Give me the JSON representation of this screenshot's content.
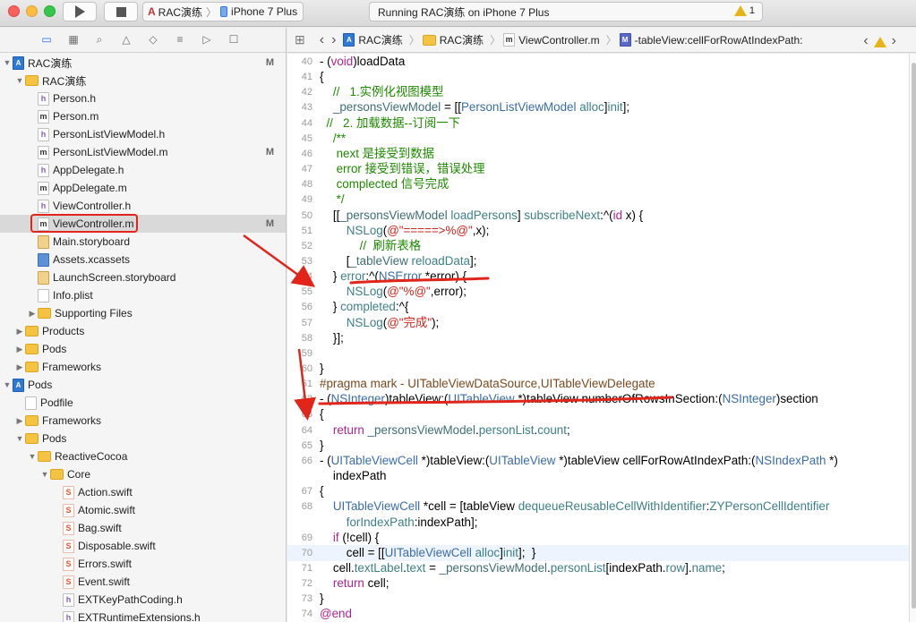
{
  "toolbar": {
    "scheme_project": "RAC演练",
    "scheme_device": "iPhone 7 Plus",
    "status": "Running RAC演练 on iPhone 7 Plus",
    "warnings": "1"
  },
  "jumpbar": {
    "items": [
      "RAC演练",
      "RAC演练",
      "ViewController.m",
      "-tableView:cellForRowAtIndexPath:"
    ]
  },
  "navigator": {
    "rows": [
      {
        "label": "RAC演练",
        "kind": "proj",
        "depth": 0,
        "disc": "▼",
        "badge": "M"
      },
      {
        "label": "RAC演练",
        "kind": "folder",
        "depth": 1,
        "disc": "▼",
        "badge": ""
      },
      {
        "label": "Person.h",
        "kind": "h",
        "depth": 2,
        "disc": "",
        "badge": ""
      },
      {
        "label": "Person.m",
        "kind": "m",
        "depth": 2,
        "disc": "",
        "badge": ""
      },
      {
        "label": "PersonListViewModel.h",
        "kind": "h",
        "depth": 2,
        "disc": "",
        "badge": ""
      },
      {
        "label": "PersonListViewModel.m",
        "kind": "m",
        "depth": 2,
        "disc": "",
        "badge": "M"
      },
      {
        "label": "AppDelegate.h",
        "kind": "h",
        "depth": 2,
        "disc": "",
        "badge": ""
      },
      {
        "label": "AppDelegate.m",
        "kind": "m",
        "depth": 2,
        "disc": "",
        "badge": ""
      },
      {
        "label": "ViewController.h",
        "kind": "h",
        "depth": 2,
        "disc": "",
        "badge": ""
      },
      {
        "label": "ViewController.m",
        "kind": "m",
        "depth": 2,
        "disc": "",
        "badge": "M",
        "selected": true
      },
      {
        "label": "Main.storyboard",
        "kind": "sb",
        "depth": 2,
        "disc": "",
        "badge": ""
      },
      {
        "label": "Assets.xcassets",
        "kind": "xc",
        "depth": 2,
        "disc": "",
        "badge": ""
      },
      {
        "label": "LaunchScreen.storyboard",
        "kind": "sb",
        "depth": 2,
        "disc": "",
        "badge": ""
      },
      {
        "label": "Info.plist",
        "kind": "plist",
        "depth": 2,
        "disc": "",
        "badge": ""
      },
      {
        "label": "Supporting Files",
        "kind": "folder",
        "depth": 2,
        "disc": "▶",
        "badge": ""
      },
      {
        "label": "Products",
        "kind": "folder",
        "depth": 1,
        "disc": "▶",
        "badge": ""
      },
      {
        "label": "Pods",
        "kind": "folder",
        "depth": 1,
        "disc": "▶",
        "badge": ""
      },
      {
        "label": "Frameworks",
        "kind": "folder",
        "depth": 1,
        "disc": "▶",
        "badge": ""
      },
      {
        "label": "Pods",
        "kind": "proj",
        "depth": 0,
        "disc": "▼",
        "badge": ""
      },
      {
        "label": "Podfile",
        "kind": "plist",
        "depth": 1,
        "disc": "",
        "badge": ""
      },
      {
        "label": "Frameworks",
        "kind": "folder",
        "depth": 1,
        "disc": "▶",
        "badge": ""
      },
      {
        "label": "Pods",
        "kind": "folder",
        "depth": 1,
        "disc": "▼",
        "badge": ""
      },
      {
        "label": "ReactiveCocoa",
        "kind": "folder",
        "depth": 2,
        "disc": "▼",
        "badge": ""
      },
      {
        "label": "Core",
        "kind": "folder",
        "depth": 3,
        "disc": "▼",
        "badge": ""
      },
      {
        "label": "Action.swift",
        "kind": "swift",
        "depth": 4,
        "disc": "",
        "badge": ""
      },
      {
        "label": "Atomic.swift",
        "kind": "swift",
        "depth": 4,
        "disc": "",
        "badge": ""
      },
      {
        "label": "Bag.swift",
        "kind": "swift",
        "depth": 4,
        "disc": "",
        "badge": ""
      },
      {
        "label": "Disposable.swift",
        "kind": "swift",
        "depth": 4,
        "disc": "",
        "badge": ""
      },
      {
        "label": "Errors.swift",
        "kind": "swift",
        "depth": 4,
        "disc": "",
        "badge": ""
      },
      {
        "label": "Event.swift",
        "kind": "swift",
        "depth": 4,
        "disc": "",
        "badge": ""
      },
      {
        "label": "EXTKeyPathCoding.h",
        "kind": "h",
        "depth": 4,
        "disc": "",
        "badge": ""
      },
      {
        "label": "EXTRuntimeExtensions.h",
        "kind": "h",
        "depth": 4,
        "disc": "",
        "badge": ""
      }
    ]
  },
  "code": {
    "lines": [
      {
        "n": "40",
        "html": "- (<span class=\"kw\">void</span>)loadData"
      },
      {
        "n": "41",
        "html": "{"
      },
      {
        "n": "42",
        "html": "    <span class=\"cm\">//   1.实例化视图模型</span>"
      },
      {
        "n": "43",
        "html": "    <span class=\"ivr\">_personsViewModel</span> = [[<span class=\"ty\">PersonListViewModel</span> <span class=\"mth\">alloc</span>]<span class=\"mth\">init</span>];"
      },
      {
        "n": "44",
        "html": "  <span class=\"cm\">//   2. 加载数据--订阅一下</span>"
      },
      {
        "n": "45",
        "html": "    <span class=\"cm\">/**</span>"
      },
      {
        "n": "46",
        "html": "     <span class=\"cm\">next 是接受到数据</span>"
      },
      {
        "n": "47",
        "html": "     <span class=\"cm\">error 接受到错误，错误处理</span>"
      },
      {
        "n": "48",
        "html": "     <span class=\"cm\">complected 信号完成</span>"
      },
      {
        "n": "49",
        "html": "     <span class=\"cm\">*/</span>"
      },
      {
        "n": "50",
        "html": "    [[<span class=\"ivr\">_personsViewModel</span> <span class=\"mth\">loadPersons</span>] <span class=\"mth\">subscribeNext</span>:^(<span class=\"kw\">id</span> x) {"
      },
      {
        "n": "51",
        "html": "        <span class=\"mth\">NSLog</span>(<span class=\"st\">@\"=====>%@\"</span>,x);"
      },
      {
        "n": "52",
        "html": "            <span class=\"cm\">//  刷新表格</span>"
      },
      {
        "n": "53",
        "html": "        [<span class=\"ivr\">_tableView</span> <span class=\"mth\">reloadData</span>];"
      },
      {
        "n": "54",
        "html": "    } <span class=\"mth\">error</span>:^(<span class=\"ty\">NSError</span> *error) {"
      },
      {
        "n": "55",
        "html": "        <span class=\"mth\">NSLog</span>(<span class=\"st\">@\"%@\"</span>,error);"
      },
      {
        "n": "56",
        "html": "    } <span class=\"mth\">completed</span>:^{"
      },
      {
        "n": "57",
        "html": "        <span class=\"mth\">NSLog</span>(<span class=\"st\">@\"完成\"</span>);"
      },
      {
        "n": "58",
        "html": "    }];"
      },
      {
        "n": "59",
        "html": ""
      },
      {
        "n": "60",
        "html": "}"
      },
      {
        "n": "61",
        "html": "<span class=\"pp\">#pragma mark - UITableViewDataSource,UITableViewDelegate</span>"
      },
      {
        "n": "62",
        "html": "- (<span class=\"ty\">NSInteger</span>)tableView:(<span class=\"ty\">UITableView</span> *)tableView numberOfRowsInSection:(<span class=\"ty\">NSInteger</span>)section"
      },
      {
        "n": "63",
        "html": "{"
      },
      {
        "n": "64",
        "html": "    <span class=\"kw\">return</span> <span class=\"ivr\">_personsViewModel</span>.<span class=\"mth\">personList</span>.<span class=\"mth\">count</span>;"
      },
      {
        "n": "65",
        "html": "}"
      },
      {
        "n": "66",
        "html": "- (<span class=\"ty\">UITableViewCell</span> *)tableView:(<span class=\"ty\">UITableView</span> *)tableView cellForRowAtIndexPath:(<span class=\"ty\">NSIndexPath</span> *)"
      },
      {
        "n": "",
        "html": "    indexPath"
      },
      {
        "n": "67",
        "html": "{"
      },
      {
        "n": "68",
        "html": "    <span class=\"ty\">UITableViewCell</span> *cell = [tableView <span class=\"mth\">dequeueReusableCellWithIdentifier</span>:<span class=\"mth\">ZYPersonCellIdentifier</span>"
      },
      {
        "n": "",
        "html": "        <span class=\"mth\">forIndexPath</span>:indexPath];"
      },
      {
        "n": "69",
        "html": "    <span class=\"kw\">if</span> (!cell) {"
      },
      {
        "n": "70",
        "html": "        cell = [[<span class=\"ty\">UITableViewCell</span> <span class=\"mth\">alloc</span>]<span class=\"mth\">init</span>];  }",
        "current": true
      },
      {
        "n": "71",
        "html": "    cell.<span class=\"mth\">textLabel</span>.<span class=\"mth\">text</span> = <span class=\"ivr\">_personsViewModel</span>.<span class=\"mth\">personList</span>[indexPath.<span class=\"mth\">row</span>].<span class=\"mth\">name</span>;"
      },
      {
        "n": "72",
        "html": "    <span class=\"kw\">return</span> cell;"
      },
      {
        "n": "73",
        "html": "}"
      },
      {
        "n": "74",
        "html": "<span class=\"kw\">@end</span>"
      }
    ]
  }
}
